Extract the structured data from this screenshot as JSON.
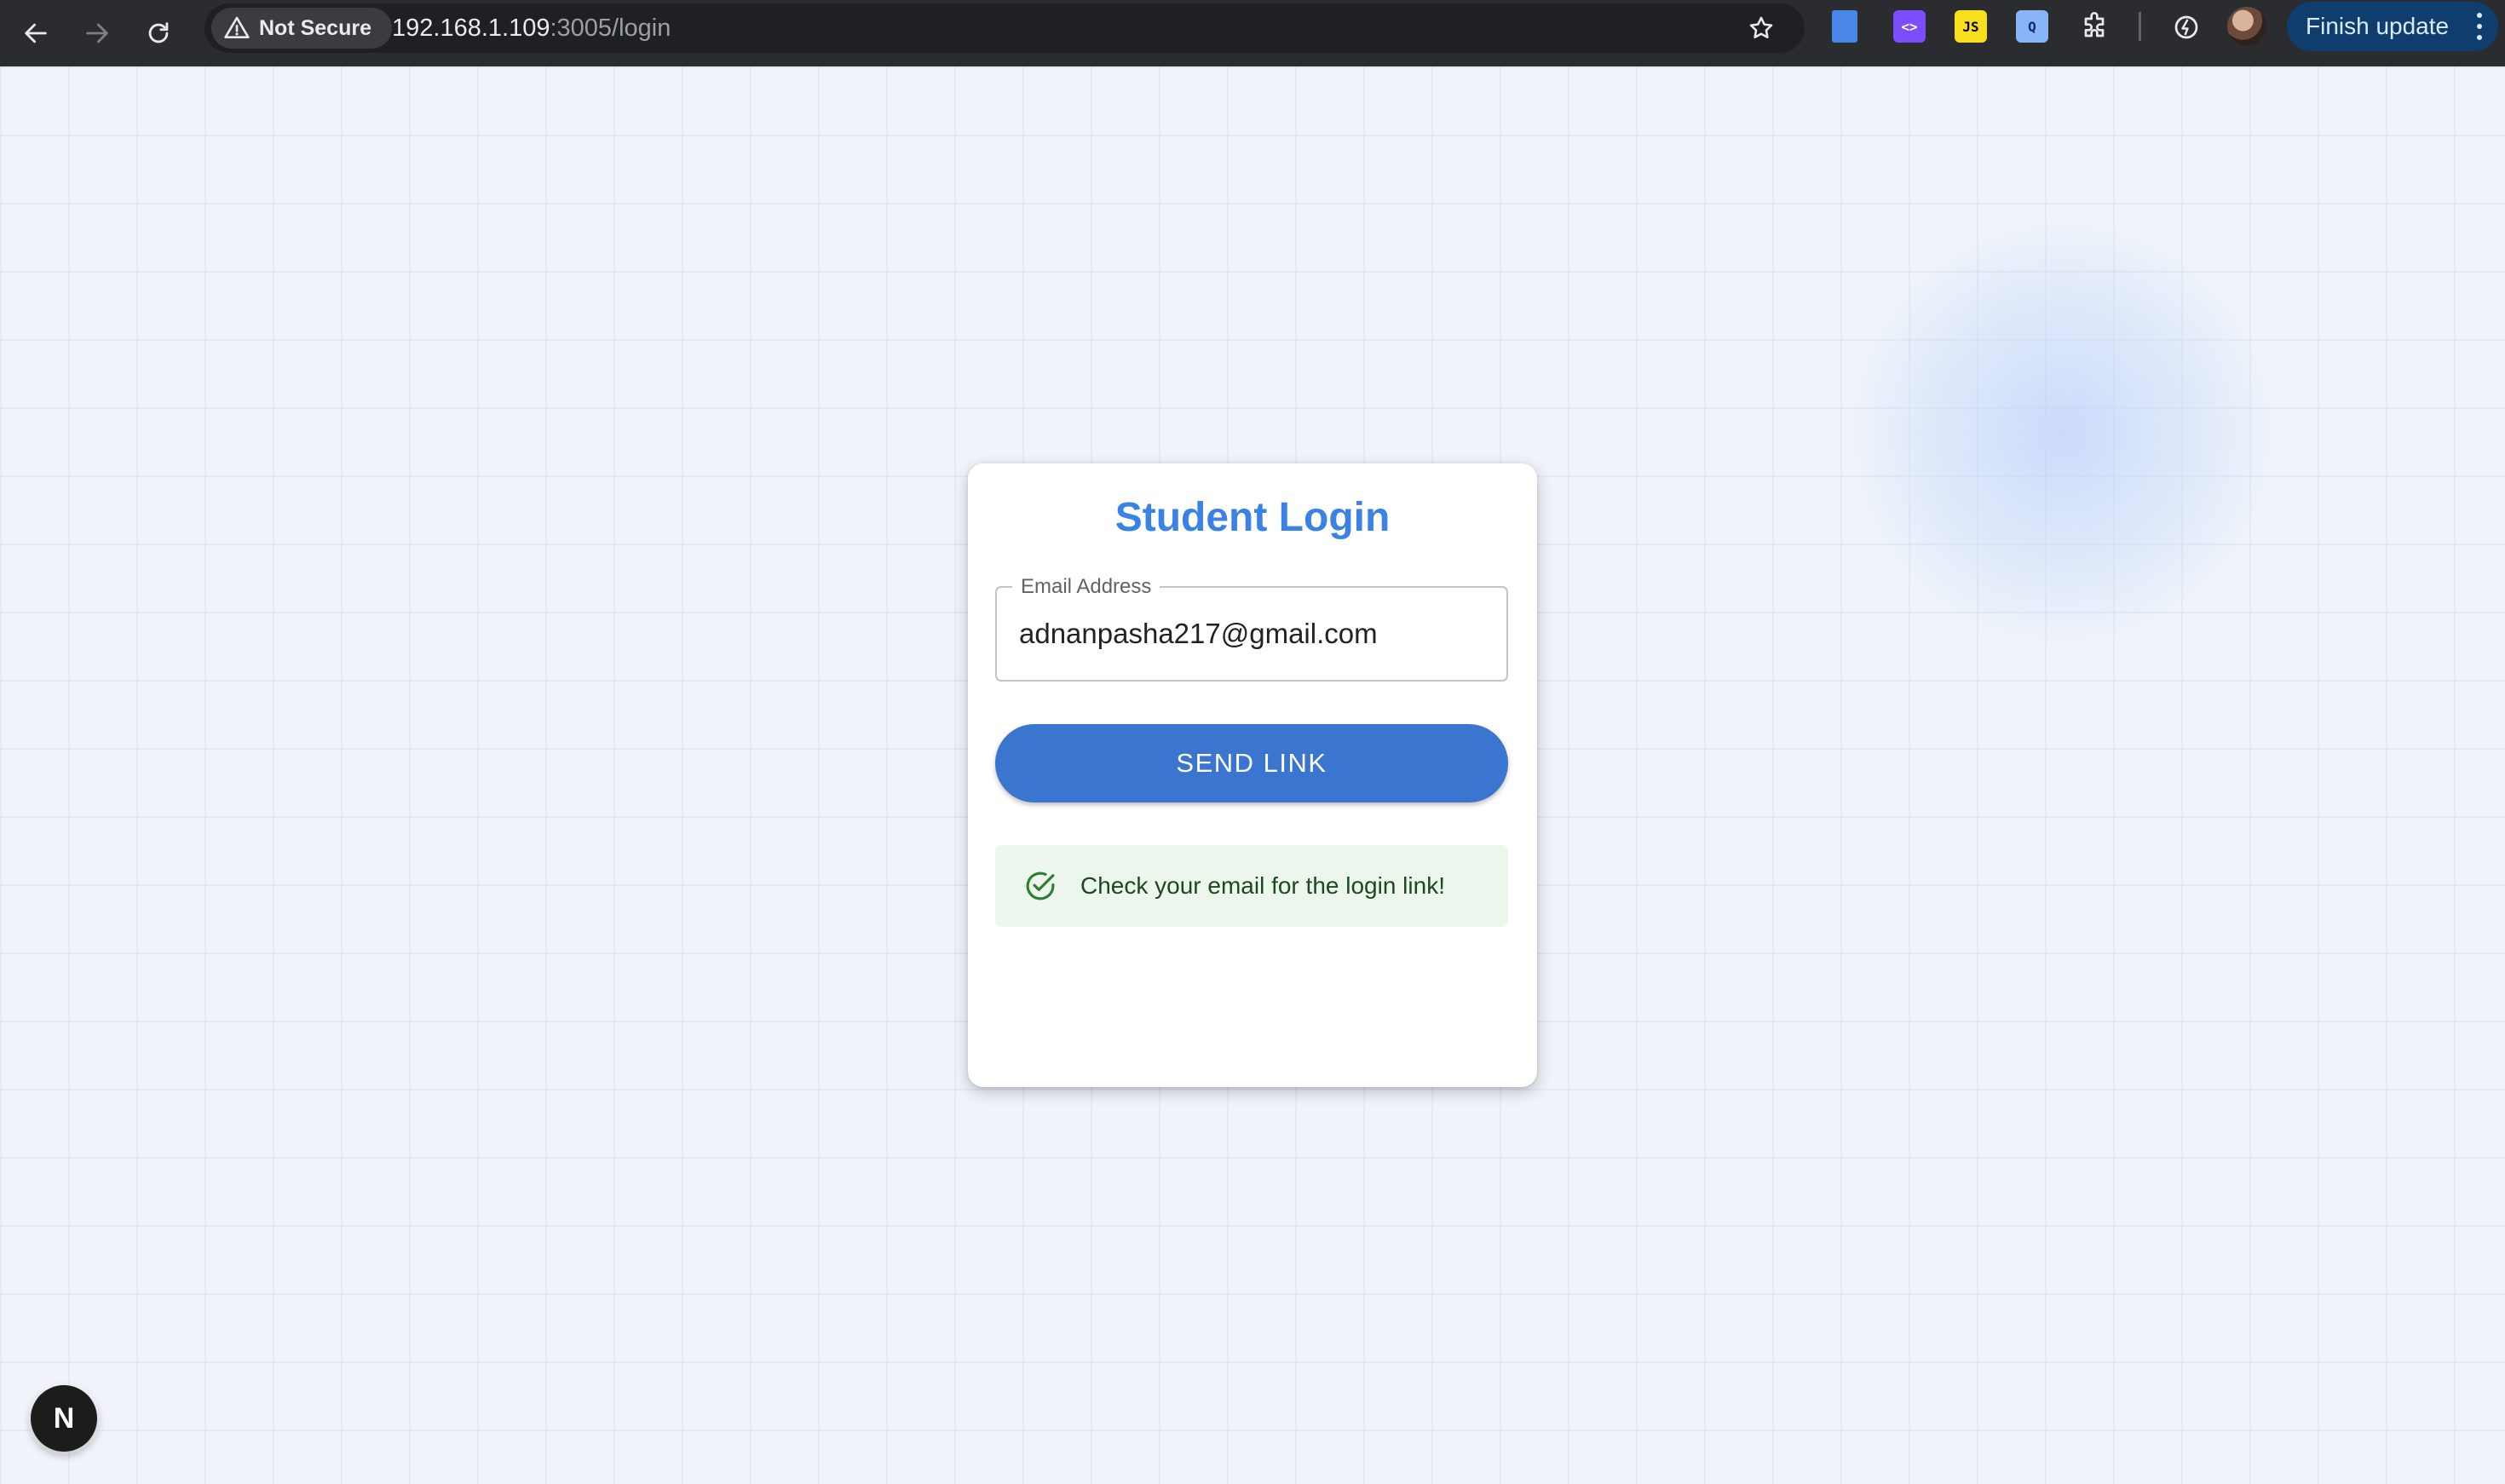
{
  "browser": {
    "security_label": "Not Secure",
    "url_host": "192.168.1.109",
    "url_path": ":3005/login",
    "update_button_label": "Finish update",
    "extensions": [
      {
        "name": "docs-extension-icon"
      },
      {
        "name": "code-extension-icon",
        "glyph": "<>"
      },
      {
        "name": "js-extension-icon",
        "glyph": "JS"
      },
      {
        "name": "inspect-extension-icon",
        "glyph": "Q"
      },
      {
        "name": "puzzle-extensions-icon"
      },
      {
        "name": "performance-icon"
      }
    ],
    "colors": {
      "chrome_bg": "#2b2c2f",
      "update_button_bg": "#0f3d6e"
    }
  },
  "login": {
    "title": "Student Login",
    "email_label": "Email Address",
    "email_value": "adnanpasha217@gmail.com",
    "send_button_label": "SEND LINK",
    "success_message": "Check your email for the login link!",
    "colors": {
      "title": "#3b82e6",
      "button": "#3a75cf",
      "alert_bg": "#edf6ed",
      "alert_icon": "#2e7d32"
    }
  },
  "dev_badge": {
    "label": "N",
    "icon": "nextjs-logo-icon"
  }
}
